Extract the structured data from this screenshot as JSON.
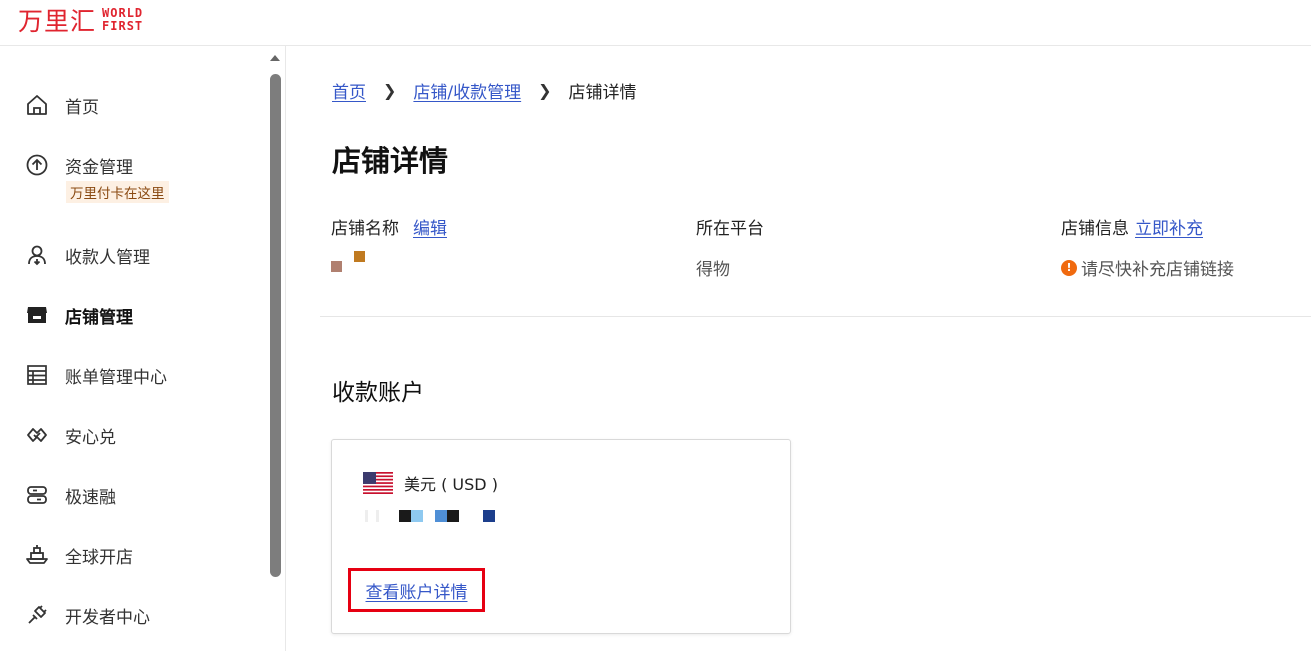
{
  "header": {
    "logo_cn": "万里汇",
    "logo_en_line1": "WORLD",
    "logo_en_line2": "FIRST"
  },
  "sidebar": {
    "items": [
      {
        "label": "首页",
        "icon": "home-icon"
      },
      {
        "label": "资金管理",
        "icon": "arrow-up-circle-icon",
        "badge": "万里付卡在这里"
      },
      {
        "label": "收款人管理",
        "icon": "user-download-icon"
      },
      {
        "label": "店铺管理",
        "icon": "store-icon",
        "active": true
      },
      {
        "label": "账单管理中心",
        "icon": "table-icon"
      },
      {
        "label": "安心兑",
        "icon": "exchange-shield-icon"
      },
      {
        "label": "极速融",
        "icon": "fast-finance-icon"
      },
      {
        "label": "全球开店",
        "icon": "ship-icon"
      },
      {
        "label": "开发者中心",
        "icon": "plug-icon"
      }
    ]
  },
  "breadcrumb": {
    "home": "首页",
    "store_mgmt": "店铺/收款管理",
    "current": "店铺详情",
    "separator": "❯"
  },
  "page": {
    "title": "店铺详情"
  },
  "store_info": {
    "name_label": "店铺名称",
    "edit_link": "编辑",
    "platform_label": "所在平台",
    "platform_value": "得物",
    "info_label": "店铺信息",
    "supplement_link": "立即补充",
    "warning_text": "请尽快补充店铺链接"
  },
  "accounts": {
    "section_title": "收款账户",
    "card": {
      "currency": "美元 ( USD )",
      "view_details": "查看账户详情"
    }
  },
  "colors": {
    "brand": "#e0242f",
    "link": "#3557c8",
    "warning": "#f06a0f",
    "highlight_box": "#e60012"
  }
}
